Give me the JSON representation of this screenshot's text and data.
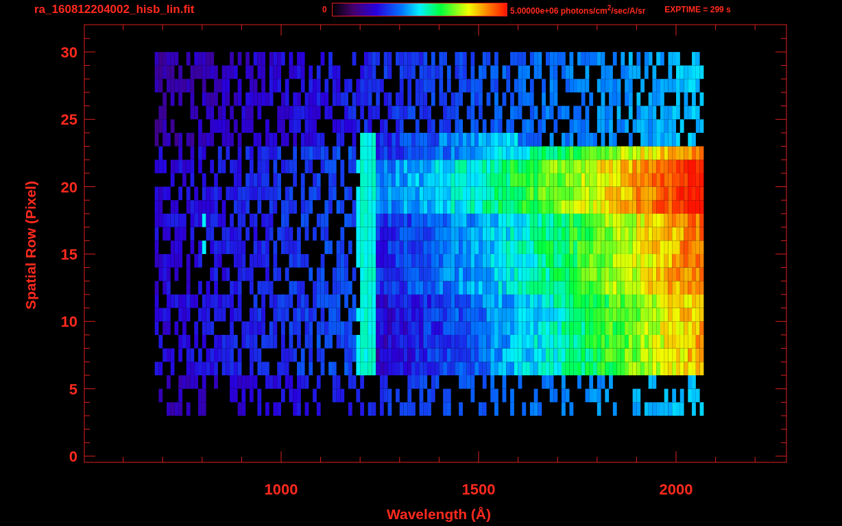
{
  "title": "ra_160812204002_hisb_lin.fit",
  "colorbar": {
    "min_label": "0",
    "max_label": "5.00000e+06 photons/cm$^{2}$/sec/A/sr"
  },
  "exposure": "EXPTIME = 299 s",
  "plot": {
    "xlabel": "Wavelength (Å)",
    "ylabel": "Spatial Row (Pixel)",
    "xticks": [
      "1000",
      "1500",
      "2000"
    ],
    "yticks": [
      "30",
      "25",
      "20",
      "15",
      "10",
      "5",
      "0"
    ]
  }
}
